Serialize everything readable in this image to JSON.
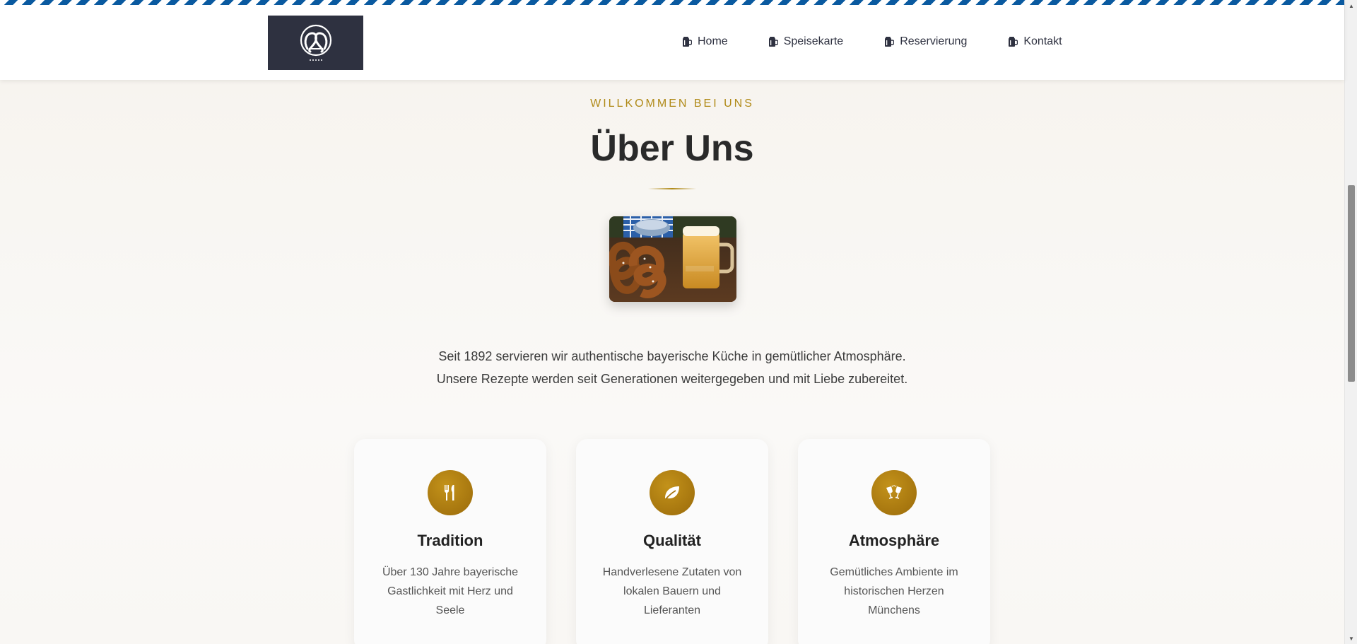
{
  "nav": {
    "items": [
      {
        "label": "Home",
        "icon": "beer-mug-icon"
      },
      {
        "label": "Speisekarte",
        "icon": "beer-mug-icon"
      },
      {
        "label": "Reservierung",
        "icon": "beer-mug-icon"
      },
      {
        "label": "Kontakt",
        "icon": "beer-mug-icon"
      }
    ]
  },
  "logo": {
    "icon": "pretzel-logo-icon"
  },
  "about": {
    "eyebrow": "WILLKOMMEN BEI UNS",
    "title": "Über Uns",
    "intro_line1": "Seit 1892 servieren wir authentische bayerische Küche in gemütlicher Atmosphäre.",
    "intro_line2": "Unsere Rezepte werden seit Generationen weitergegeben und mit Liebe zubereitet."
  },
  "cards": [
    {
      "title": "Tradition",
      "text": "Über 130 Jahre bayerische Gastlichkeit mit Herz und Seele",
      "icon": "utensils-icon"
    },
    {
      "title": "Qualität",
      "text": "Handverlesene Zutaten von lokalen Bauern und Lieferanten",
      "icon": "leaf-icon"
    },
    {
      "title": "Atmosphäre",
      "text": "Gemütliches Ambiente im historischen Herzen Münchens",
      "icon": "glasses-cheers-icon"
    }
  ],
  "colors": {
    "accent": "#b08a18",
    "logo_bg": "#2e3140",
    "bavarian_blue": "#0a5aa0"
  }
}
